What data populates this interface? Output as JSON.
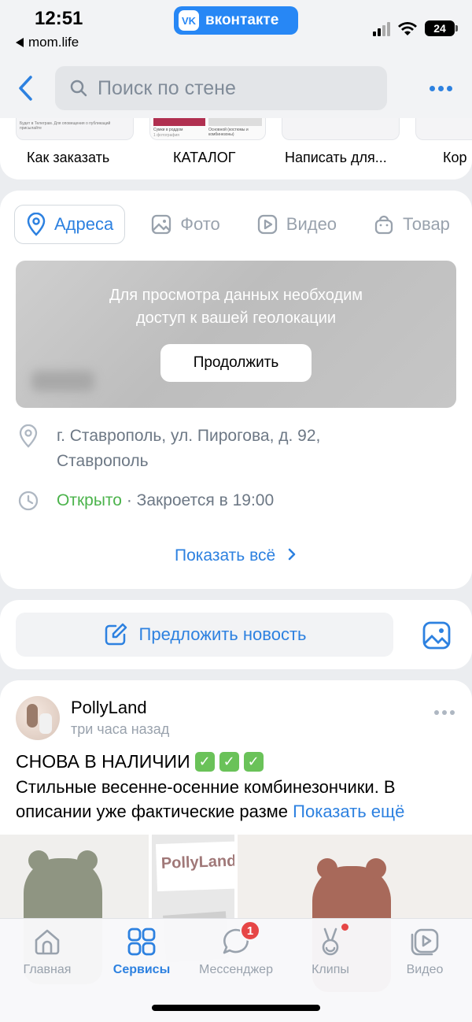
{
  "status_bar": {
    "time": "12:51",
    "back_app": "mom.life",
    "vk_badge": "вконтакте",
    "vk_logo": "VK",
    "battery": "24"
  },
  "header": {
    "search_placeholder": "Поиск по стене"
  },
  "menu_items": [
    {
      "label": "Как заказать",
      "thumb_text": "Будет в Телеграм. Для оповещения о публикаций присылайте"
    },
    {
      "label": "КАТАЛОГ",
      "thumb_text": "Сумки в роддом · Основной (костюмы и комбинезоны)"
    },
    {
      "label": "Написать для...",
      "thumb_text": ""
    },
    {
      "label": "Кор",
      "thumb_text": ""
    }
  ],
  "menu_thumb_captions": {
    "catalog_left": "Сумки в роддом",
    "catalog_left_sub": "1 фотография",
    "catalog_right": "Основной (костюмы и комбинезоны)"
  },
  "tabs": [
    {
      "label": "Адреса",
      "icon": "location-pin-icon",
      "active": true
    },
    {
      "label": "Фото",
      "icon": "photo-icon",
      "active": false
    },
    {
      "label": "Видео",
      "icon": "video-icon",
      "active": false
    },
    {
      "label": "Товар",
      "icon": "shopping-bag-icon",
      "active": false
    }
  ],
  "geo": {
    "message_line1": "Для просмотра данных необходим",
    "message_line2": "доступ к вашей геолокации",
    "continue_label": "Продолжить"
  },
  "address": {
    "line1": "г. Ставрополь, ул. Пирогова, д. 92,",
    "line2": "Ставрополь"
  },
  "hours": {
    "status": "Открыто",
    "closes": " · Закроется в 19:00"
  },
  "show_all_label": "Показать всё",
  "suggest": {
    "label": "Предложить новость"
  },
  "post": {
    "author": "PollyLand",
    "time": "три часа назад",
    "title": "СНОВА В НАЛИЧИИ",
    "text": "Стильные весенне-осенние комбинезончики. В описании уже фактические разме",
    "show_more": "Показать ещё",
    "photo_brand": "PollyLand"
  },
  "tabbar": [
    {
      "label": "Главная",
      "icon": "home-icon",
      "active": false
    },
    {
      "label": "Сервисы",
      "icon": "services-grid-icon",
      "active": true
    },
    {
      "label": "Мессенджер",
      "icon": "messenger-icon",
      "active": false,
      "badge": "1"
    },
    {
      "label": "Клипы",
      "icon": "clips-icon",
      "active": false
    },
    {
      "label": "Видео",
      "icon": "video-play-icon",
      "active": false
    }
  ],
  "colors": {
    "accent": "#2d81e0",
    "open_green": "#4bb34b",
    "badge_red": "#e64646",
    "vk_blue": "#2787f5"
  }
}
